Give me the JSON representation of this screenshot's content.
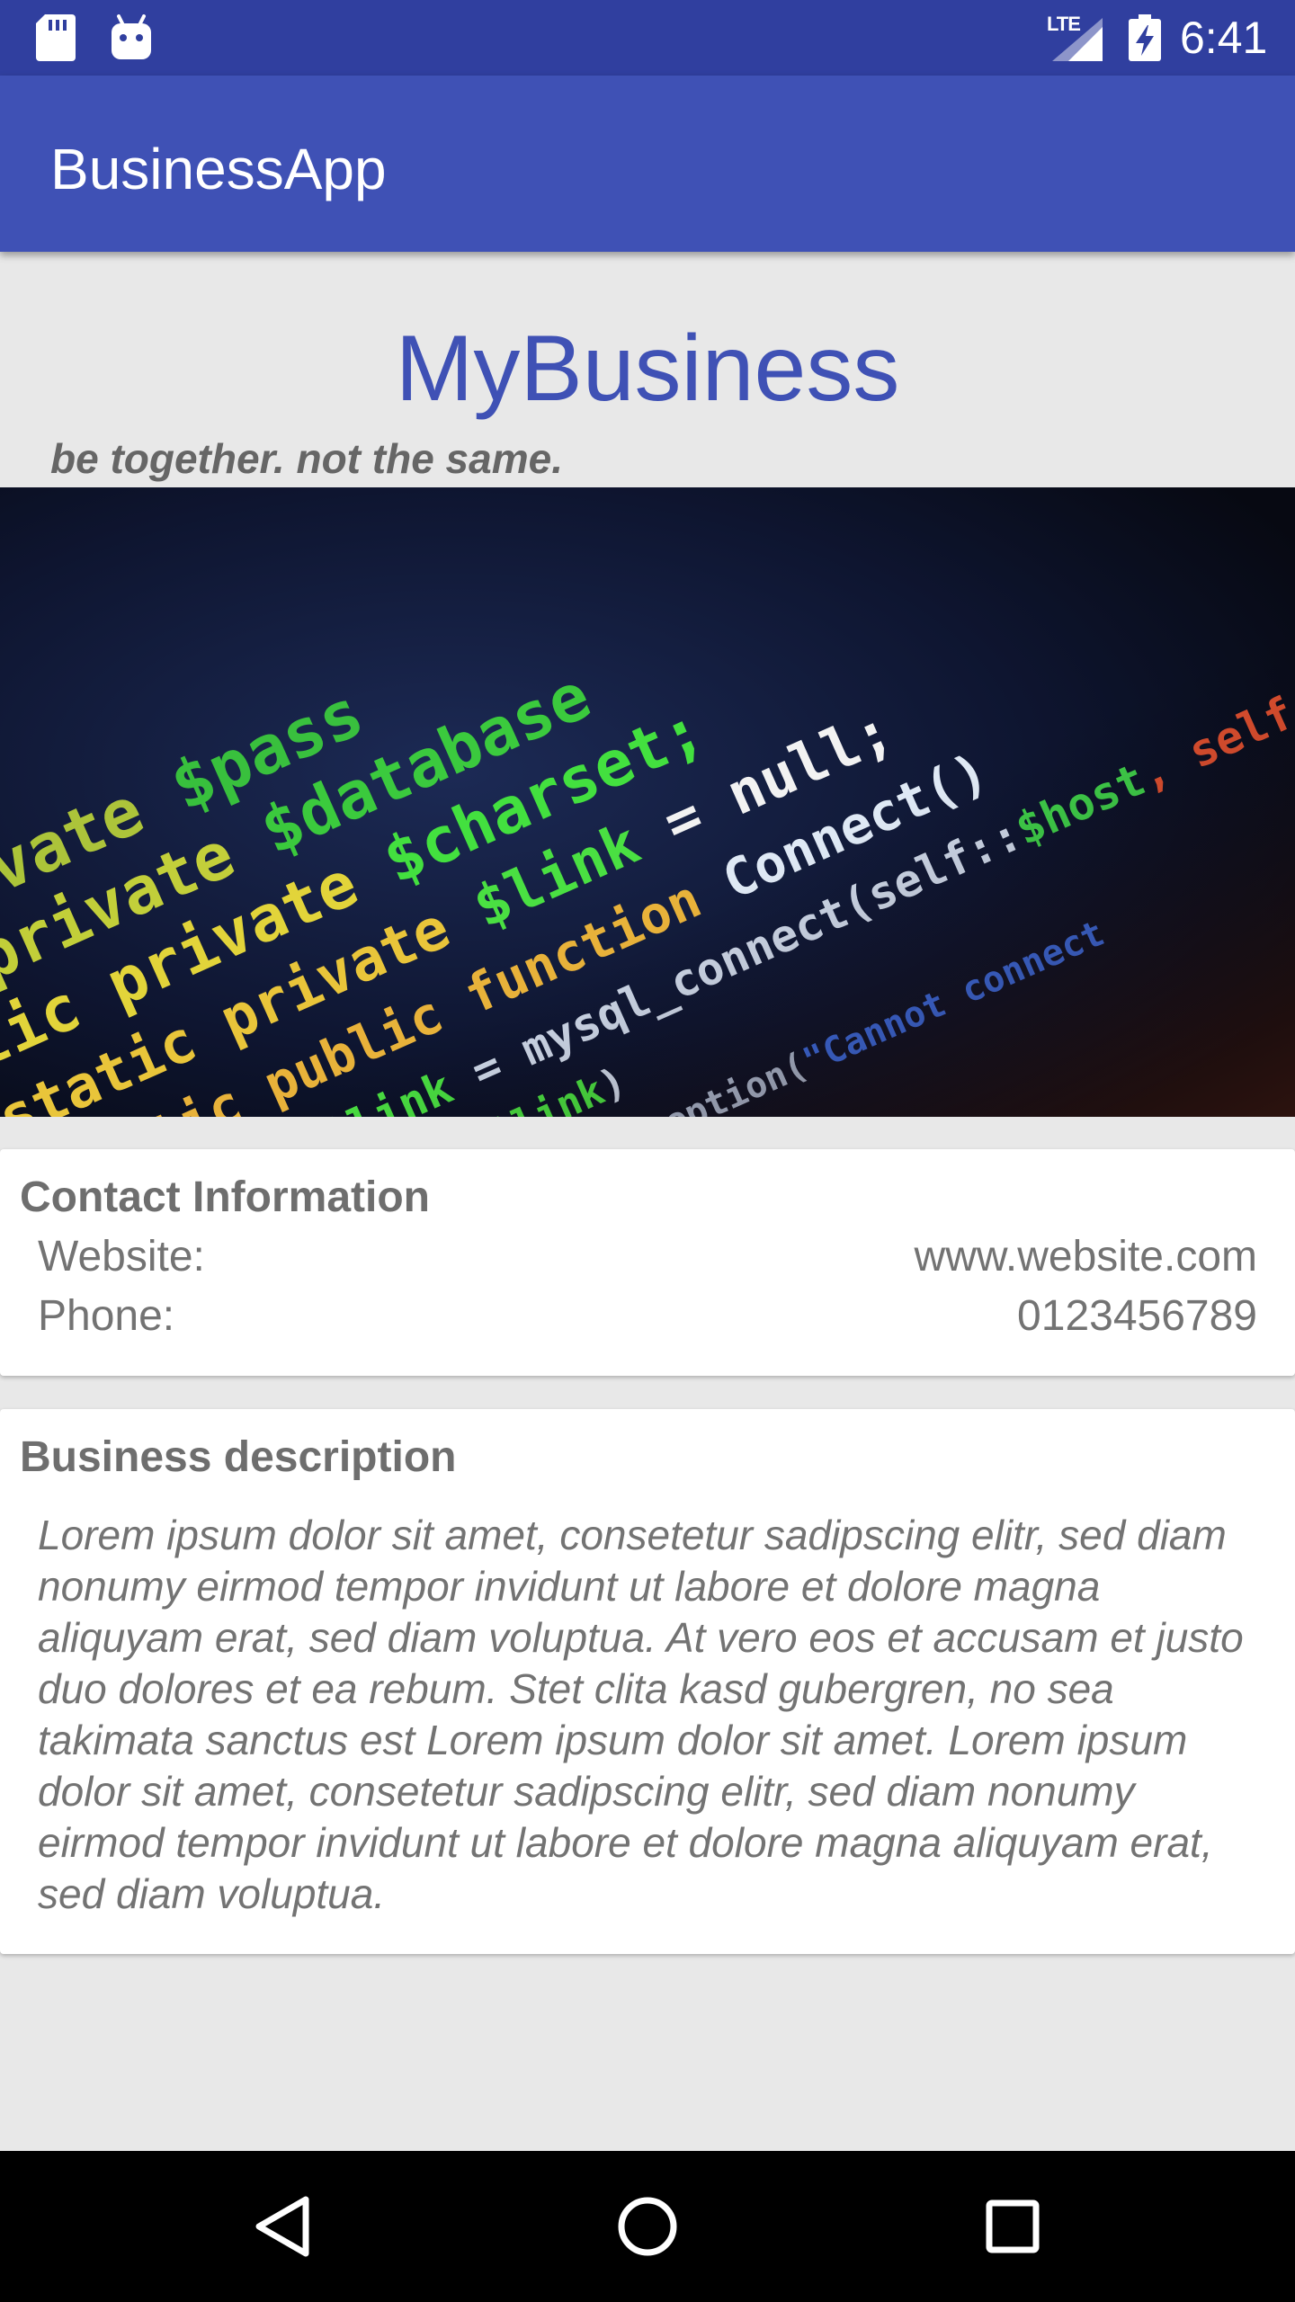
{
  "status_bar": {
    "time": "6:41",
    "network_label": "LTE",
    "left_icons": [
      "sd-card-icon",
      "android-icon"
    ],
    "right_icons": [
      "signal-icon",
      "battery-charging-icon"
    ],
    "background": "#303f9f"
  },
  "app_bar": {
    "title": "BusinessApp",
    "background": "#3f51b5"
  },
  "header": {
    "business_name": "MyBusiness",
    "tagline": "be together. not the same.",
    "accent_color": "#3f51b5"
  },
  "hero_image": {
    "icon": "code-screenshot-image",
    "code_lines": [
      "private $pass",
      "private $database",
      "private $charset;",
      "static private $link = null;",
      "static public function Connect()",
      "self::$link = mysql_connect(self::$host,",
      "(!self::$link)",
      "throw new MysqlException(\"Cannot connect"
    ]
  },
  "contact": {
    "title": "Contact Information",
    "rows": [
      {
        "label": "Website:",
        "value": "www.website.com"
      },
      {
        "label": "Phone:",
        "value": "0123456789"
      }
    ]
  },
  "description": {
    "title": "Business description",
    "text": "Lorem ipsum dolor sit amet, consetetur sadipscing elitr, sed diam nonumy eirmod tempor invidunt ut labore et dolore magna aliquyam erat, sed diam voluptua. At vero eos et accusam et justo duo dolores et ea rebum. Stet clita kasd gubergren, no sea takimata sanctus est Lorem ipsum dolor sit amet. Lorem ipsum dolor sit amet, consetetur sadipscing elitr, sed diam nonumy eirmod tempor invidunt ut labore et dolore magna aliquyam erat, sed diam voluptua."
  },
  "nav_bar": {
    "buttons": [
      "back-icon",
      "home-icon",
      "recents-icon"
    ]
  }
}
